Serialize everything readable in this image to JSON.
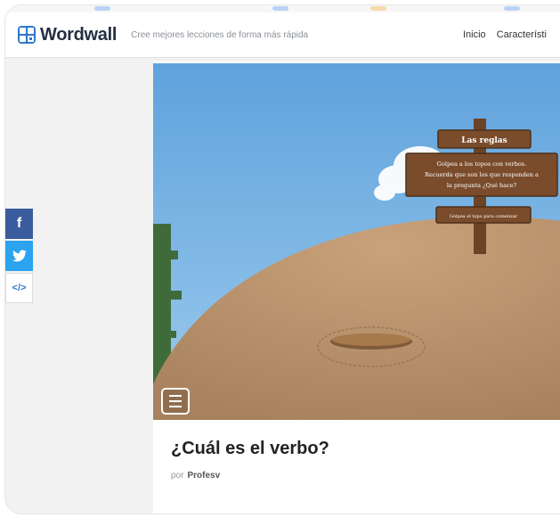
{
  "header": {
    "logo_text": "Wordwall",
    "tagline": "Cree mejores lecciones de forma más rápida",
    "nav": [
      "Inicio",
      "Característi"
    ]
  },
  "share": {
    "facebook_icon": "f",
    "twitter_icon": "twitter-bird-icon",
    "embed_icon": "</>"
  },
  "game": {
    "sign_title": "Las reglas",
    "sign_line1": "Golpea a los topos con verbos.",
    "sign_line2": "Recuerda que son los que responden a",
    "sign_line3": "la pregunta ¿Qué hace?",
    "sign_button": "Golpea el topo para comenzar"
  },
  "activity": {
    "title": "¿Cuál es el verbo?",
    "by_label": "por",
    "author": "Profesv"
  },
  "colors": {
    "sky": "#7ab8e6",
    "dirt": "#b99572",
    "brand": "#2f79c9",
    "facebook": "#3b5c9c",
    "twitter": "#2ba3ef"
  }
}
